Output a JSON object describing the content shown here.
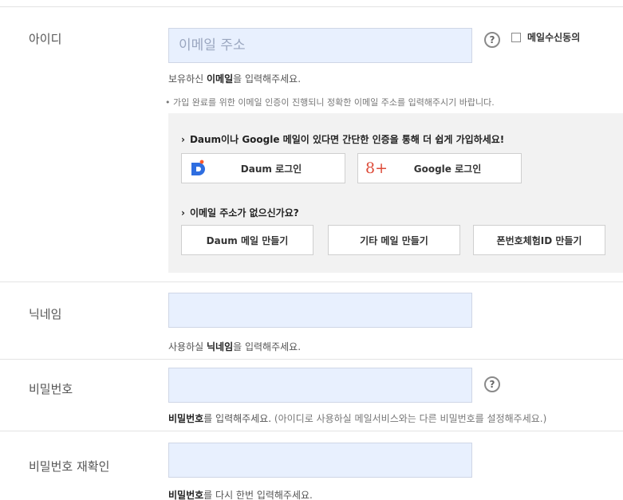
{
  "id_section": {
    "label": "아이디",
    "placeholder": "이메일 주소",
    "help": "?",
    "consent_label": "메일수신동의",
    "hint_prefix": "보유하신 ",
    "hint_strong": "이메일",
    "hint_suffix": "을 입력해주세요.",
    "note": "• 가입 완료를 위한 이메일 인증이 진행되니 정확한 이메일 주소를 입력해주시기 바랍니다."
  },
  "social_panel": {
    "title": "Daum이나 Google 메일이 있다면 간단한 인증을 통해 더 쉽게 가입하세요!",
    "daum_login": "Daum 로그인",
    "google_login": "Google 로그인",
    "google_logo": "8+",
    "daum_logo": "D",
    "no_email_title": "이메일 주소가 없으신가요?",
    "create_daum": "Daum 메일 만들기",
    "create_other": "기타 메일 만들기",
    "create_phone": "폰번호체험ID 만들기"
  },
  "nickname_section": {
    "label": "닉네임",
    "hint_prefix": "사용하실 ",
    "hint_strong": "닉네임",
    "hint_suffix": "을 입력해주세요."
  },
  "password_section": {
    "label": "비밀번호",
    "help": "?",
    "hint_strong": "비밀번호",
    "hint_suffix": "를 입력해주세요. ",
    "hint_sub": "(아이디로 사용하실 메일서비스와는 다른 비밀번호를 설정해주세요.)"
  },
  "confirm_section": {
    "label": "비밀번호 재확인",
    "hint_strong": "비밀번호",
    "hint_suffix": "를 다시 한번 입력해주세요."
  },
  "colors": {
    "input_bg": "#e8f0fe",
    "panel_bg": "#f2f2f2",
    "daum_blue": "#2f6ee0",
    "google_red": "#dd4b39"
  }
}
